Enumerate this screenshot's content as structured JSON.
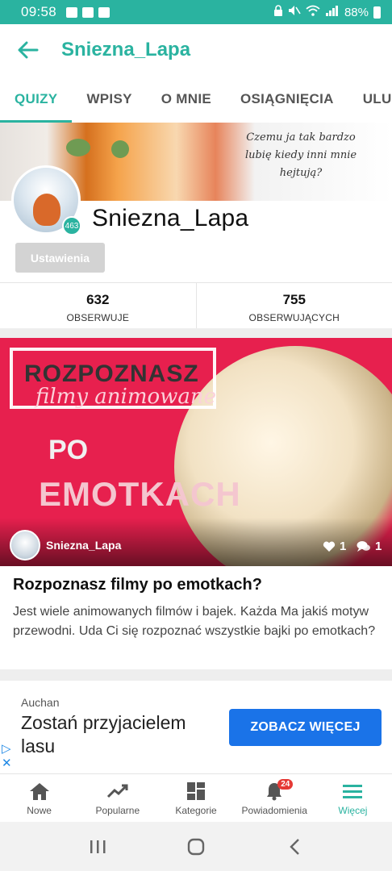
{
  "status_bar": {
    "time": "09:58",
    "battery": "88%"
  },
  "app_bar": {
    "title": "Sniezna_Lapa"
  },
  "tabs": [
    {
      "label": "QUIZY",
      "active": true
    },
    {
      "label": "WPISY",
      "active": false
    },
    {
      "label": "O MNIE",
      "active": false
    },
    {
      "label": "OSIĄGNIĘCIA",
      "active": false
    },
    {
      "label": "ULUBIO",
      "active": false
    }
  ],
  "profile": {
    "cover_quote": "Czemu ja tak bardzo lubię kiedy inni mnie hejtują?",
    "username": "Sniezna_Lapa",
    "level_badge": "463",
    "settings_label": "Ustawienia"
  },
  "stats": {
    "following_count": "632",
    "following_label": "OBSERWUJE",
    "followers_count": "755",
    "followers_label": "OBSERWUJĄCYCH"
  },
  "quiz": {
    "image_text_1": "ROZPOZNASZ",
    "image_text_2": "filmy animowane",
    "image_text_3": "PO",
    "image_text_4": "EMOTKACH",
    "author": "Sniezna_Lapa",
    "likes": "1",
    "comments": "1",
    "title": "Rozpoznasz filmy po emotkach?",
    "description": "Jest wiele animowanych filmów i bajek. Każda Ma jakiś motyw przewodni. Uda Ci się rozpoznać wszystkie bajki po emotkach?"
  },
  "ad": {
    "brand": "Auchan",
    "headline": "Zostań przyjacielem lasu",
    "cta": "ZOBACZ WIĘCEJ"
  },
  "bottom_nav": [
    {
      "label": "Nowe",
      "icon": "home-icon",
      "active": false
    },
    {
      "label": "Popularne",
      "icon": "trending-icon",
      "active": false
    },
    {
      "label": "Kategorie",
      "icon": "grid-icon",
      "active": false
    },
    {
      "label": "Powiadomienia",
      "icon": "bell-icon",
      "active": false,
      "badge": "24"
    },
    {
      "label": "Więcej",
      "icon": "menu-icon",
      "active": true
    }
  ],
  "colors": {
    "accent": "#2ab3a0",
    "ad_button": "#1a73e8",
    "notification_badge": "#e53935"
  }
}
